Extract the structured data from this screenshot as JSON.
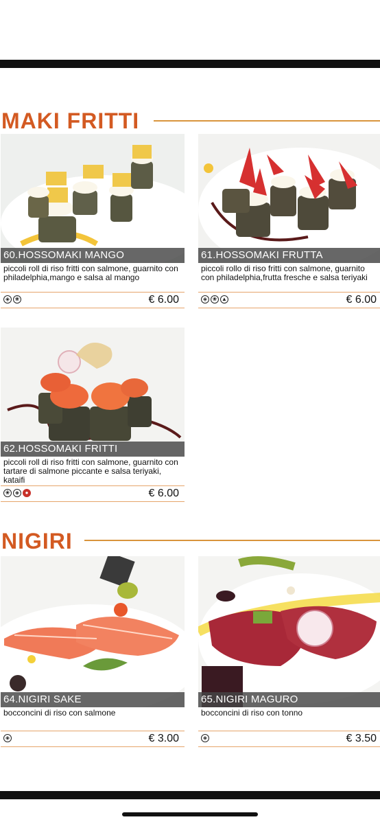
{
  "sections": [
    {
      "title": "MAKI FRITTI"
    },
    {
      "title": "NIGIRI"
    }
  ],
  "items": [
    {
      "name": "60.HOSSOMAKI MANGO",
      "desc": "piccoli roll di riso fritti con salmone, guarnito con philadelphia,mango e salsa al mango",
      "price": "€ 6.00",
      "icons": [
        "fish-icon",
        "leaf-icon"
      ]
    },
    {
      "name": "61.HOSSOMAKI FRUTTA",
      "desc": "piccoli rollo di riso fritti con salmone, guarnito con philadelphia,frutta fresche e salsa teriyaki",
      "price": "€ 6.00",
      "icons": [
        "fish-icon",
        "leaf-icon",
        "bottle-icon"
      ]
    },
    {
      "name": "62.HOSSOMAKI FRITTI",
      "desc": "piccoli roll di riso fritti con salmone, guarnito con tartare di salmone piccante e salsa teriyaki, kataifi",
      "price": "€ 6.00",
      "icons": [
        "leaf-icon",
        "fish-icon",
        "chili-icon"
      ]
    },
    {
      "name": "64.NIGIRI SAKE",
      "desc": "bocconcini di riso con salmone",
      "price": "€ 3.00",
      "icons": [
        "fish-icon"
      ]
    },
    {
      "name": "65.NIGIRI MAGURO",
      "desc": "bocconcini di riso con tonno",
      "price": "€ 3.50",
      "icons": [
        "fish-icon"
      ]
    }
  ],
  "colors": {
    "accent": "#d35a22",
    "rule": "#e6a46a",
    "strip": "#464646"
  }
}
